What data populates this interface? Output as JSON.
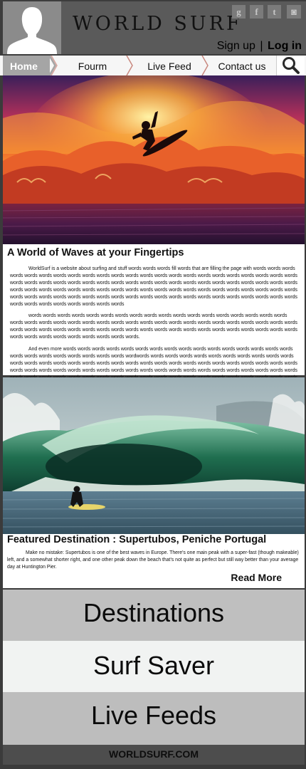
{
  "site": {
    "brand": "WORLD SURF",
    "footer": "WORLDSURF.COM"
  },
  "header": {
    "social": [
      {
        "icon": "google-plus-icon",
        "glyph": "g"
      },
      {
        "icon": "facebook-icon",
        "glyph": "f"
      },
      {
        "icon": "twitter-icon",
        "glyph": "t"
      },
      {
        "icon": "instagram-icon",
        "glyph": "◙"
      }
    ],
    "signup": "Sign up",
    "separator": "|",
    "login": "Log in"
  },
  "nav": {
    "home": "Home",
    "forum": "Fourm",
    "live_feed": "Live Feed",
    "contact": "Contact us",
    "search_icon": "search-icon"
  },
  "section1": {
    "title": "A World of Waves at your Fingertips",
    "p1": "WorldSurf is a website about surfing and stuff words words words fill words that are filling the page with words words words words words words words words words words words words words words words words words words words words words words words words words words words words words words words words words words words words words words words words words words words words words words words words words words words words words words words words words words words words words words words words words words words words words words words words words words words words words words words words words words words words words words words words words words words",
    "p2": "words words words words words words words words words words words words words words words words words words words words words words words words words words words words words words words words words words words words words words words words words words words words words words words words words words words words words words words words words words words words words words words words words words words.",
    "p3": "And even more words words words words words words words words words words words words words words words words words words words words words words words words wordwords words words words words words words words words words words words words words words words words words words words words words words words words words words words words words words words words words words words words words words words words words words words words words words words words words words words words words words words words words words words words words words words words words words words words words words words words words words words words words words words words ."
  },
  "section2": {
    "title": "Featured Destination : Supertubos, Peniche Portugal",
    "body": "Make no mistake: Supertubos is one of the best waves in Europe. There's one main peak with a super-fast (though makeable) left, and a somewhat shorter right, and one other peak down the beach that's not quite as perfect but still way better than your average day at Huntington Pier.",
    "read_more": "Read More"
  },
  "buttons": {
    "destinations": "Destinations",
    "surf_saver": "Surf Saver",
    "live_feeds": "Live Feeds"
  },
  "colors": {
    "header": "#3d3d3d",
    "header_panel": "#5a5a5a",
    "nav_active": "#a5a5a5",
    "accent_sep": "#c9887f"
  }
}
